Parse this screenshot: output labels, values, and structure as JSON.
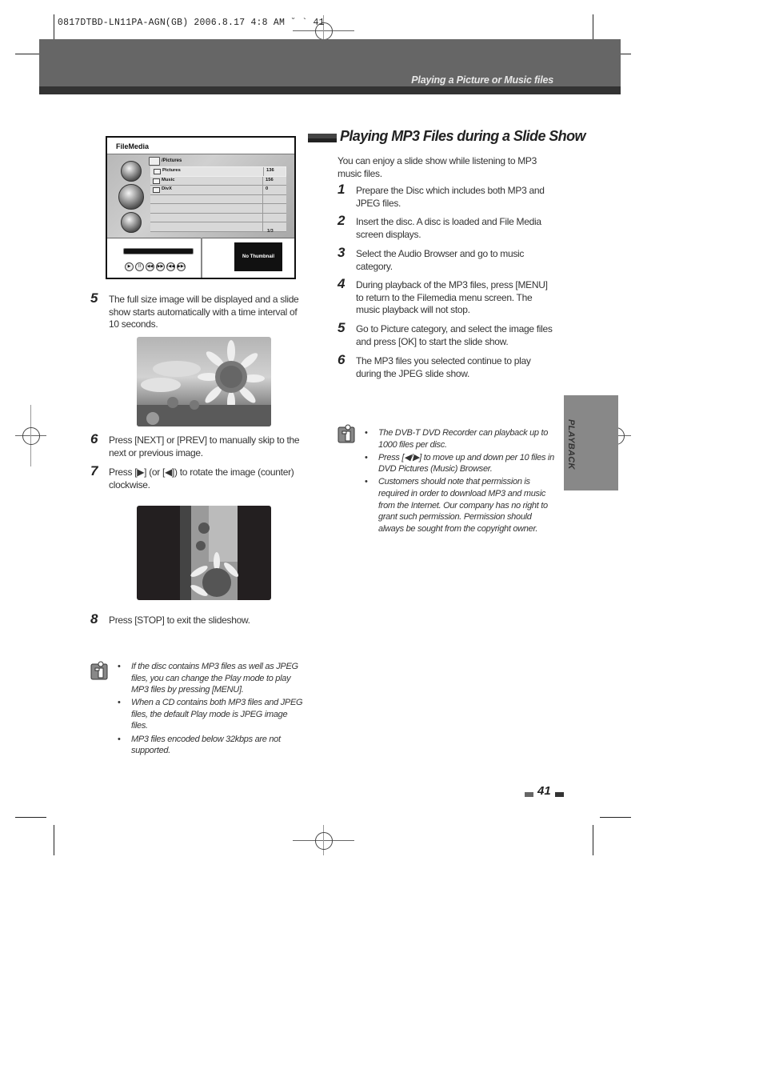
{
  "print_slug": "0817DTBD-LN11PA-AGN(GB) 2006.8.17 4:8 AM ˘ ` 41",
  "header": {
    "section_title": "Playing a Picture or Music files"
  },
  "side_tab": {
    "label": "PLAYBACK"
  },
  "page_number": "41",
  "colors": {
    "header_band": "#666666",
    "header_dark": "#333333",
    "side_tab": "#888888",
    "text": "#333333"
  },
  "filemedia_screen": {
    "title": "FileMedia",
    "path": "/Pictures",
    "side_icons": [
      "music-icon",
      "picture-icon",
      "divx-icon"
    ],
    "rows": [
      {
        "name": "Pictures",
        "count": "136"
      },
      {
        "name": "Music",
        "count": "156"
      },
      {
        "name": "DivX",
        "count": "0"
      }
    ],
    "pager": "1/3",
    "thumbnail_label": "No Thumbnail",
    "controls": [
      "▶",
      "II",
      "◀◀",
      "▶▶",
      "I◀◀",
      "▶▶I"
    ]
  },
  "left_steps": [
    {
      "num": "5",
      "text": "The full size image will be displayed and a slide show starts automatically with a time interval of 10 seconds."
    },
    {
      "num": "6",
      "text": "Press [NEXT] or [PREV] to manually skip to the next or previous image."
    },
    {
      "num": "7",
      "text": "Press [▶] (or [◀]) to rotate the image (counter) clockwise."
    },
    {
      "num": "8",
      "text": "Press [STOP] to exit the slideshow."
    }
  ],
  "left_notes": [
    "If the disc contains MP3 files as well as JPEG files, you can change the Play mode to play MP3 files by pressing [MENU].",
    "When a CD contains both MP3 files and JPEG files, the default Play mode is JPEG image files.",
    "MP3 files encoded below 32kbps are not supported."
  ],
  "right_section": {
    "title": "Playing MP3 Files during a Slide Show",
    "intro": "You can enjoy a slide show while listening to MP3 music files.",
    "steps": [
      {
        "num": "1",
        "text": "Prepare the Disc which includes both MP3 and JPEG files."
      },
      {
        "num": "2",
        "text": "Insert the disc. A disc is loaded and File Media screen displays."
      },
      {
        "num": "3",
        "text": "Select the Audio Browser and go to music category."
      },
      {
        "num": "4",
        "text": "During playback of the MP3 files, press [MENU] to return to the Filemedia menu screen. The music playback will not stop."
      },
      {
        "num": "5",
        "text": "Go to Picture category, and select the image files and press [OK] to start the slide show."
      },
      {
        "num": "6",
        "text": "The MP3 files you selected continue to play during the JPEG slide show."
      }
    ],
    "notes": [
      "The DVB-T DVD Recorder can playback up to 1000 files per disc.",
      "Press [◀/▶] to move up and down per 10 files in DVD Pictures (Music) Browser.",
      "Customers should note that permission is required in order to download MP3  and music from the Internet. Our company has no right to grant such permission. Permission should always be sought from the copyright owner."
    ]
  },
  "images": {
    "sunflower_full": "sunflower-photo",
    "sunflower_rotated": "sunflower-rotated-photo"
  }
}
